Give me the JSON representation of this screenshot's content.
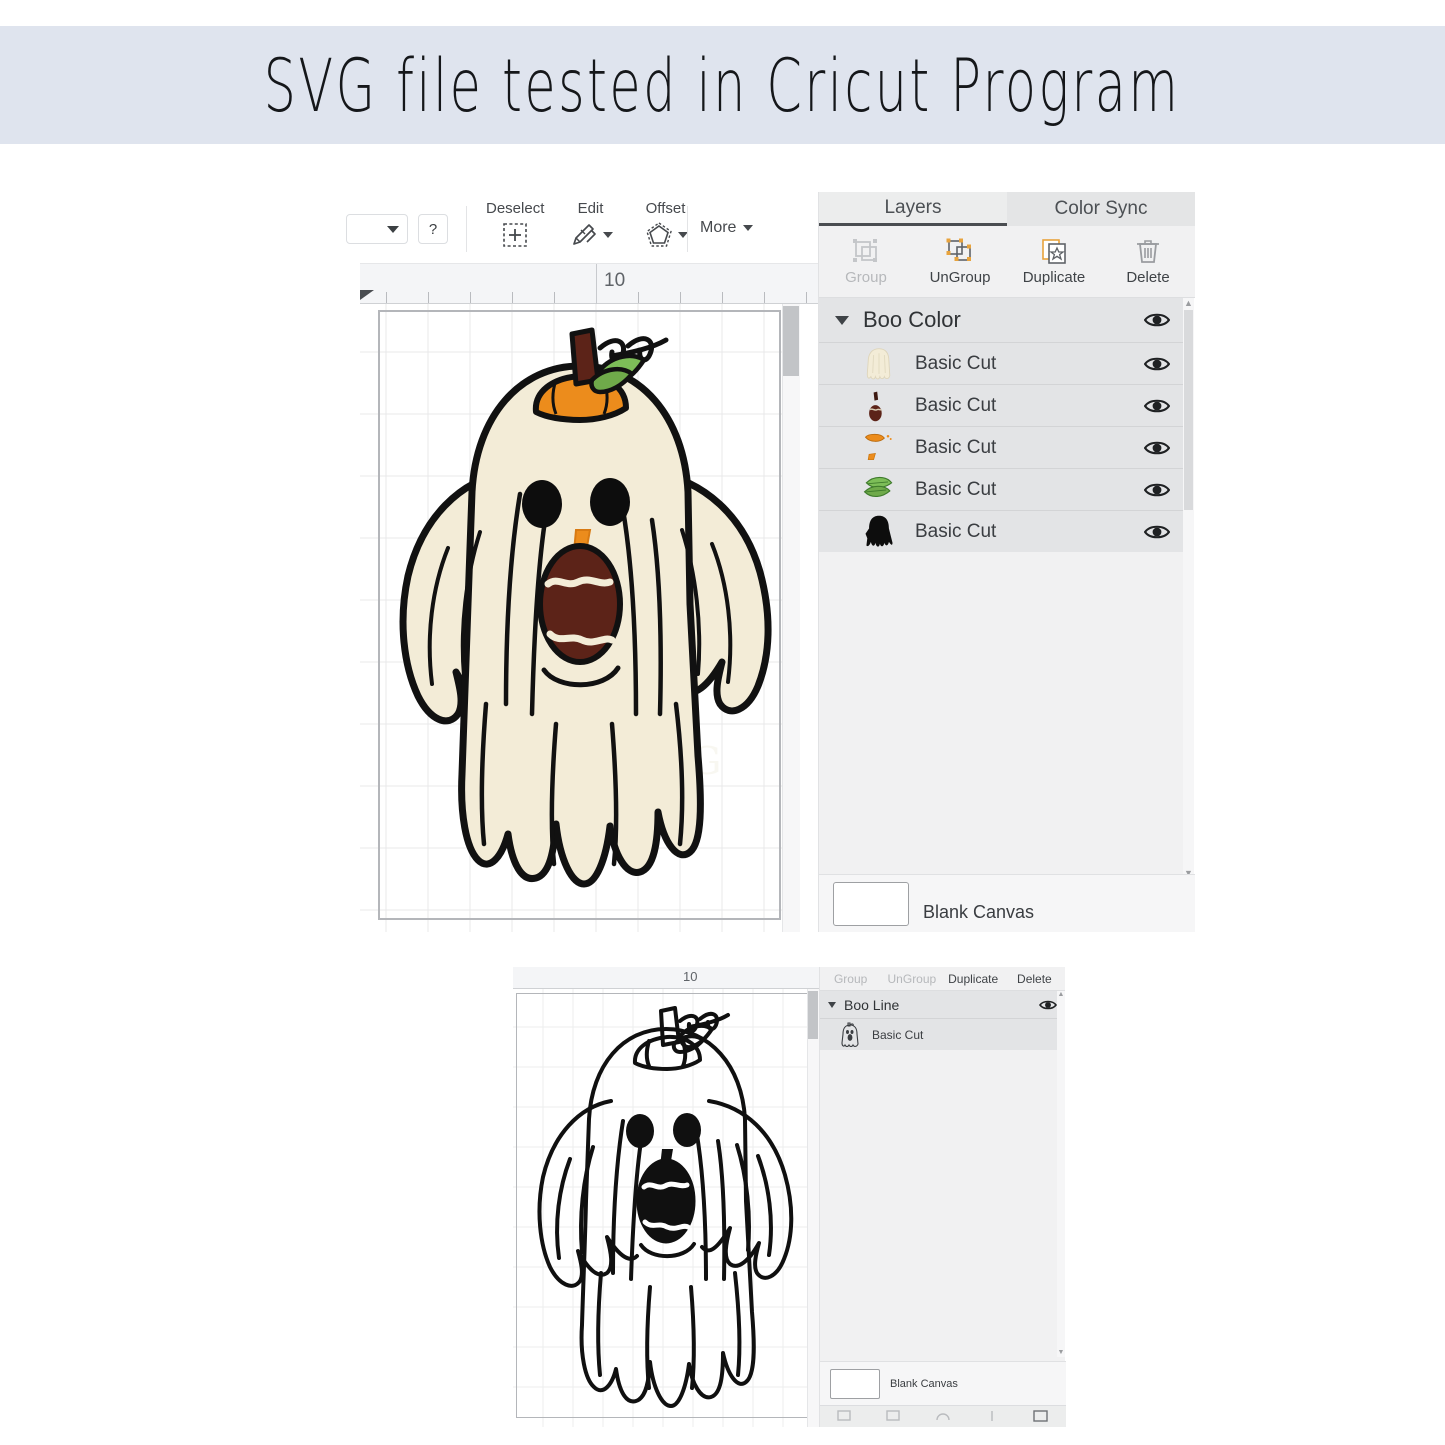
{
  "banner": {
    "title": "SVG file tested in Cricut Program",
    "bg_color": "#dfe4ee"
  },
  "top_screenshot": {
    "toolbar": {
      "help_label": "?",
      "items": [
        {
          "label": "Deselect",
          "icon": "deselect-icon"
        },
        {
          "label": "Edit",
          "icon": "edit-pencil-icon"
        },
        {
          "label": "Offset",
          "icon": "offset-icon"
        }
      ],
      "more_label": "More"
    },
    "ruler": {
      "label": "10",
      "unit": "in"
    },
    "canvas": {
      "watermark_text": "AN DESIG"
    },
    "panel": {
      "tabs": [
        {
          "label": "Layers",
          "active": true
        },
        {
          "label": "Color Sync",
          "active": false
        }
      ],
      "actions": [
        {
          "label": "Group",
          "icon": "group-icon",
          "disabled": true
        },
        {
          "label": "UnGroup",
          "icon": "ungroup-icon",
          "disabled": false
        },
        {
          "label": "Duplicate",
          "icon": "duplicate-icon",
          "disabled": false
        },
        {
          "label": "Delete",
          "icon": "trash-icon",
          "disabled": false
        }
      ],
      "group": {
        "name": "Boo Color",
        "visible": true
      },
      "layers": [
        {
          "name": "Basic Cut",
          "thumb": "ghost-cream",
          "color": "#f3ecd7"
        },
        {
          "name": "Basic Cut",
          "thumb": "stem-mouth-brown",
          "color": "#5c2318"
        },
        {
          "name": "Basic Cut",
          "thumb": "pumpkin-orange",
          "color": "#ec8c1c"
        },
        {
          "name": "Basic Cut",
          "thumb": "leaves-green",
          "color": "#6faa4a"
        },
        {
          "name": "Basic Cut",
          "thumb": "ghost-black",
          "color": "#0d0d0d"
        }
      ],
      "footer": {
        "label": "Blank Canvas",
        "swatch_color": "#ffffff"
      }
    }
  },
  "bottom_screenshot": {
    "ruler": {
      "label": "10"
    },
    "panel": {
      "actions": [
        {
          "label": "Group",
          "disabled": true
        },
        {
          "label": "UnGroup",
          "disabled": true
        },
        {
          "label": "Duplicate",
          "disabled": false
        },
        {
          "label": "Delete",
          "disabled": false
        }
      ],
      "group": {
        "name": "Boo Line",
        "visible": true
      },
      "layers": [
        {
          "name": "Basic Cut",
          "thumb": "ghost-line",
          "color": "#222222"
        }
      ],
      "footer": {
        "label": "Blank Canvas",
        "swatch_color": "#ffffff"
      }
    }
  },
  "colors": {
    "ghost_body": "#f3ecd7",
    "outline": "#111111",
    "pumpkin": "#ec8c1c",
    "stem": "#5c2318",
    "mouth": "#5c2318",
    "leaf": "#6faa4a",
    "panel_bg": "#f1f1f2",
    "row_bg": "#e3e4e6"
  }
}
